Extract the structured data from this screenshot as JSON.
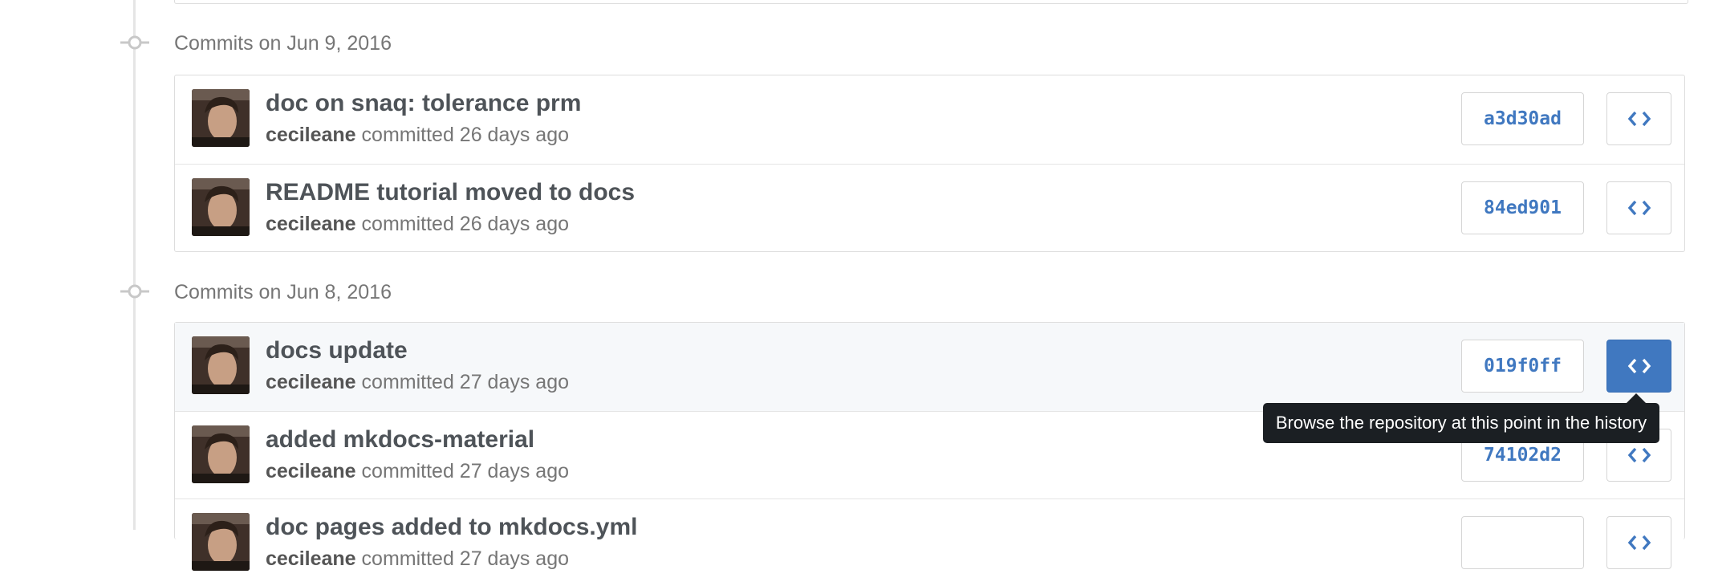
{
  "groups": [
    {
      "label": "Commits on Jun 9, 2016",
      "commits": [
        {
          "title": "doc on snaq: tolerance prm",
          "author": "cecileane",
          "meta": "committed 26 days ago",
          "sha": "a3d30ad"
        },
        {
          "title": "README tutorial moved to docs",
          "author": "cecileane",
          "meta": "committed 26 days ago",
          "sha": "84ed901"
        }
      ]
    },
    {
      "label": "Commits on Jun 8, 2016",
      "commits": [
        {
          "title": "docs update",
          "author": "cecileane",
          "meta": "committed 27 days ago",
          "sha": "019f0ff"
        },
        {
          "title": "added mkdocs-material",
          "author": "cecileane",
          "meta": "committed 27 days ago",
          "sha": "74102d2"
        },
        {
          "title": "doc pages added to mkdocs.yml",
          "author": "cecileane",
          "meta": "committed 27 days ago",
          "sha": ""
        }
      ]
    }
  ],
  "tooltip": {
    "text": "Browse the repository at this point in the history"
  },
  "colors": {
    "link": "#4078c0",
    "tooltip_bg": "#1b1f23",
    "hover_row": "#f6f8fa"
  },
  "icons": {
    "commit_node": "git-commit-icon",
    "browse": "code-icon"
  }
}
